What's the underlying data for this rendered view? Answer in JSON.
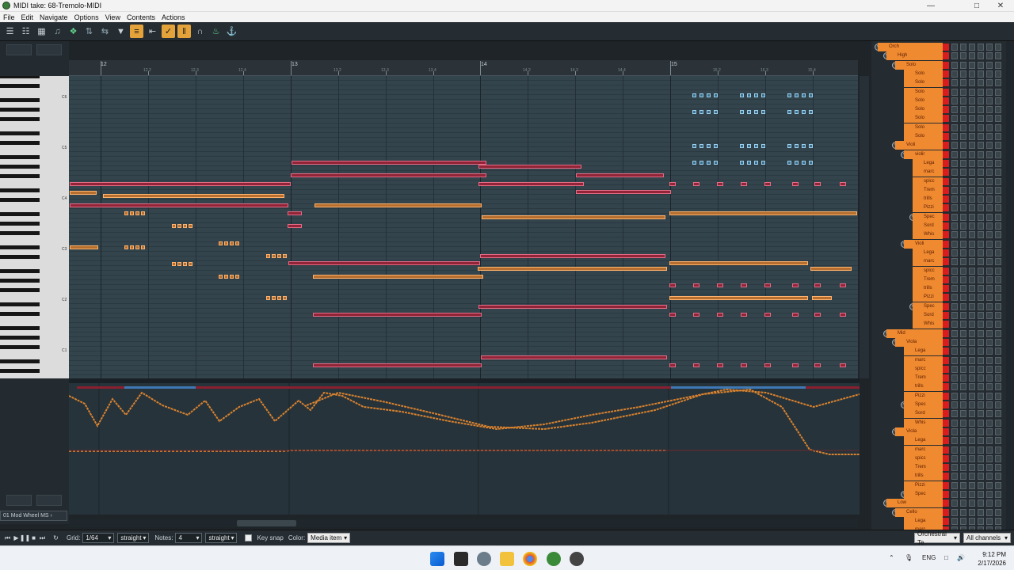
{
  "window": {
    "title": "MIDI take: 68-Tremolo-MIDI"
  },
  "menu": [
    "File",
    "Edit",
    "Navigate",
    "Options",
    "View",
    "Contents",
    "Actions"
  ],
  "ruler": {
    "bars": [
      "12",
      "13",
      "14",
      "15"
    ],
    "subdivisions": [
      "12.2",
      "12.3",
      "12.4",
      "13.2",
      "13.3",
      "13.4",
      "14.2",
      "14.3",
      "14.4",
      "15.2",
      "15.3",
      "15.4"
    ]
  },
  "keyboard": {
    "octave_labels": [
      "C6",
      "C5",
      "C4",
      "C3",
      "C2",
      "C1"
    ]
  },
  "cc_lane": {
    "selector": "01 Mod Wheel MS"
  },
  "bottom_bar": {
    "grid_label": "Grid:",
    "grid_value": "1/64",
    "grid_mode": "straight",
    "notes_label": "Notes:",
    "notes_value": "4",
    "notes_mode": "straight",
    "key_snap": "Key snap",
    "color_label": "Color:",
    "color_value": "Media item",
    "bank_value": "Orchestral Te",
    "channels_value": "All channels"
  },
  "tracks": [
    {
      "name": "Orch",
      "indent": 0,
      "fold": true
    },
    {
      "name": "High",
      "indent": 1,
      "fold": true
    },
    {
      "name": "Solo",
      "indent": 2,
      "fold": true
    },
    {
      "name": "Solo",
      "indent": 3,
      "fold": false
    },
    {
      "name": "Solo",
      "indent": 3,
      "fold": false
    },
    {
      "name": "Solo",
      "indent": 3,
      "fold": false
    },
    {
      "name": "Solo",
      "indent": 3,
      "fold": false
    },
    {
      "name": "Solo",
      "indent": 3,
      "fold": false
    },
    {
      "name": "Solo",
      "indent": 3,
      "fold": false
    },
    {
      "name": "Solo",
      "indent": 3,
      "fold": false
    },
    {
      "name": "Solo",
      "indent": 3,
      "fold": false
    },
    {
      "name": "Violi",
      "indent": 2,
      "fold": true
    },
    {
      "name": "violir",
      "indent": 3,
      "fold": true
    },
    {
      "name": "Lega",
      "indent": 4,
      "fold": false
    },
    {
      "name": "marc",
      "indent": 4,
      "fold": false
    },
    {
      "name": "spicc",
      "indent": 4,
      "fold": false
    },
    {
      "name": "Trem",
      "indent": 4,
      "fold": false
    },
    {
      "name": "trills",
      "indent": 4,
      "fold": false
    },
    {
      "name": "Pizzi",
      "indent": 4,
      "fold": false
    },
    {
      "name": "Spec",
      "indent": 4,
      "fold": true
    },
    {
      "name": "Sord",
      "indent": 4,
      "fold": false
    },
    {
      "name": "Whis",
      "indent": 4,
      "fold": false
    },
    {
      "name": "Violi",
      "indent": 3,
      "fold": true
    },
    {
      "name": "Lega",
      "indent": 4,
      "fold": false
    },
    {
      "name": "marc",
      "indent": 4,
      "fold": false
    },
    {
      "name": "spicc",
      "indent": 4,
      "fold": false
    },
    {
      "name": "Trem",
      "indent": 4,
      "fold": false
    },
    {
      "name": "trills",
      "indent": 4,
      "fold": false
    },
    {
      "name": "Pizzi",
      "indent": 4,
      "fold": false
    },
    {
      "name": "Spec",
      "indent": 4,
      "fold": true
    },
    {
      "name": "Sord",
      "indent": 4,
      "fold": false
    },
    {
      "name": "Whis",
      "indent": 4,
      "fold": false
    },
    {
      "name": "Mid",
      "indent": 1,
      "fold": true
    },
    {
      "name": "Viola",
      "indent": 2,
      "fold": true
    },
    {
      "name": "Lega",
      "indent": 3,
      "fold": false
    },
    {
      "name": "marc",
      "indent": 3,
      "fold": false
    },
    {
      "name": "spicc",
      "indent": 3,
      "fold": false
    },
    {
      "name": "Trem",
      "indent": 3,
      "fold": false
    },
    {
      "name": "trills",
      "indent": 3,
      "fold": false
    },
    {
      "name": "Pizzi",
      "indent": 3,
      "fold": false
    },
    {
      "name": "Spec",
      "indent": 3,
      "fold": true
    },
    {
      "name": "Sord",
      "indent": 3,
      "fold": false
    },
    {
      "name": "Whis",
      "indent": 3,
      "fold": false
    },
    {
      "name": "Viola",
      "indent": 2,
      "fold": true
    },
    {
      "name": "Lega",
      "indent": 3,
      "fold": false
    },
    {
      "name": "marc",
      "indent": 3,
      "fold": false
    },
    {
      "name": "spicc",
      "indent": 3,
      "fold": false
    },
    {
      "name": "Trem",
      "indent": 3,
      "fold": false
    },
    {
      "name": "trills",
      "indent": 3,
      "fold": false
    },
    {
      "name": "Pizzi",
      "indent": 3,
      "fold": false
    },
    {
      "name": "Spec",
      "indent": 3,
      "fold": true
    },
    {
      "name": "Low",
      "indent": 1,
      "fold": true
    },
    {
      "name": "Cello",
      "indent": 2,
      "fold": true
    },
    {
      "name": "Lega",
      "indent": 3,
      "fold": false
    },
    {
      "name": "marc",
      "indent": 3,
      "fold": false
    }
  ],
  "taskbar": {
    "language": "ENG",
    "time": "9:12 PM",
    "date": "2/17/2026"
  },
  "colors": {
    "note_red": "#922437",
    "note_orange": "#b66f2e",
    "note_blue": "#3c6f8c",
    "track_orange": "#f08a31",
    "accent": "#e4a23a"
  }
}
